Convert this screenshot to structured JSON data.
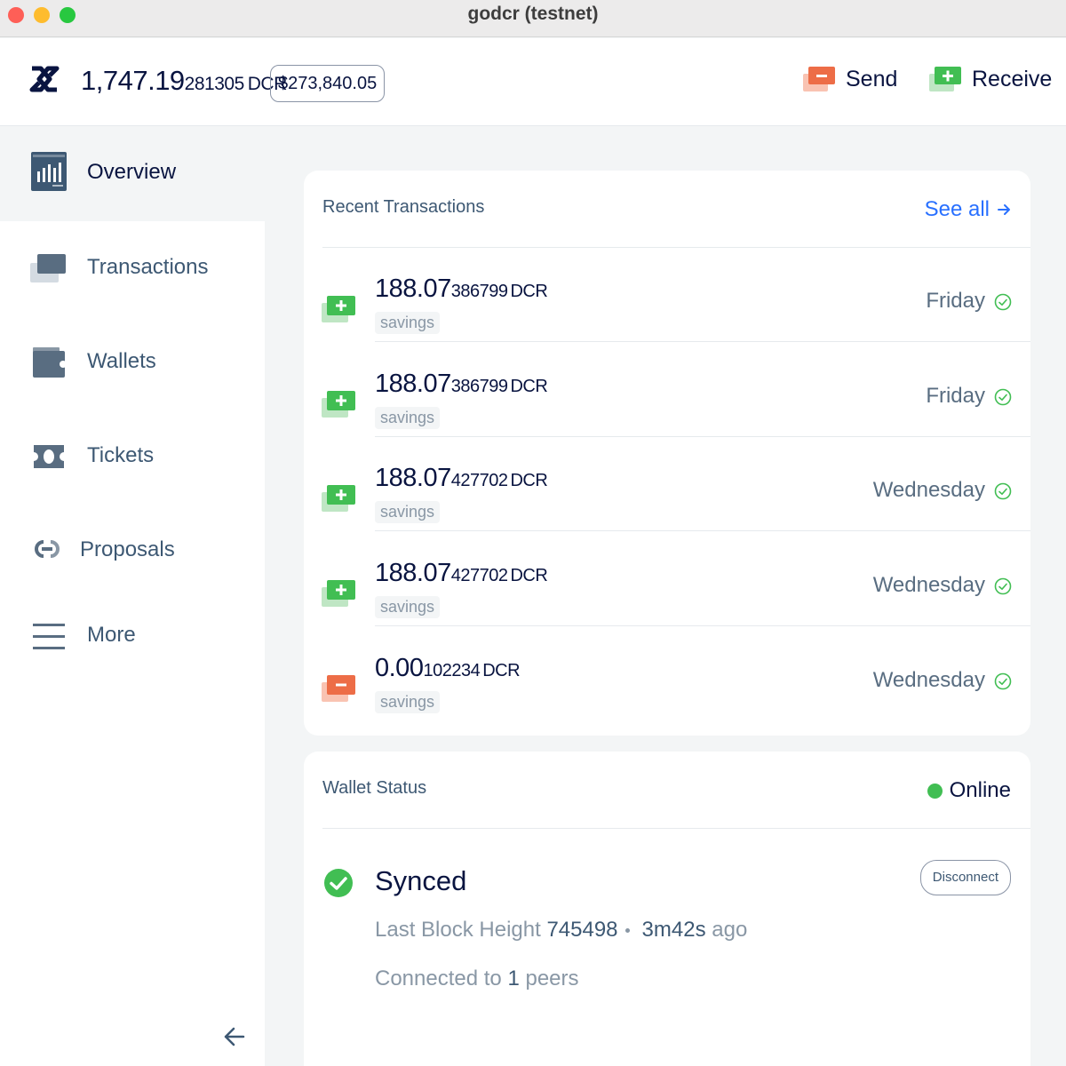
{
  "window": {
    "title": "godcr (testnet)"
  },
  "header": {
    "balance_main": "1,747.19",
    "balance_small": "281305",
    "balance_unit": "DCR",
    "usd_value": "$273,840.05",
    "send_label": "Send",
    "receive_label": "Receive"
  },
  "sidebar": {
    "items": [
      {
        "label": "Overview",
        "icon": "overview-icon",
        "active": true
      },
      {
        "label": "Transactions",
        "icon": "transactions-icon"
      },
      {
        "label": "Wallets",
        "icon": "wallets-icon"
      },
      {
        "label": "Tickets",
        "icon": "tickets-icon"
      },
      {
        "label": "Proposals",
        "icon": "proposals-icon"
      },
      {
        "label": "More",
        "icon": "more-icon"
      }
    ]
  },
  "recent": {
    "title": "Recent Transactions",
    "see_all": "See all",
    "transactions": [
      {
        "type": "received",
        "amount_main": "188.07",
        "amount_small": "386799",
        "unit": "DCR",
        "wallet": "savings",
        "date": "Friday",
        "status": "confirmed"
      },
      {
        "type": "received",
        "amount_main": "188.07",
        "amount_small": "386799",
        "unit": "DCR",
        "wallet": "savings",
        "date": "Friday",
        "status": "confirmed"
      },
      {
        "type": "received",
        "amount_main": "188.07",
        "amount_small": "427702",
        "unit": "DCR",
        "wallet": "savings",
        "date": "Wednesday",
        "status": "confirmed"
      },
      {
        "type": "received",
        "amount_main": "188.07",
        "amount_small": "427702",
        "unit": "DCR",
        "wallet": "savings",
        "date": "Wednesday",
        "status": "confirmed"
      },
      {
        "type": "sent",
        "amount_main": "0.00",
        "amount_small": "102234",
        "unit": "DCR",
        "wallet": "savings",
        "date": "Wednesday",
        "status": "confirmed"
      }
    ]
  },
  "status": {
    "title": "Wallet Status",
    "online_label": "Online",
    "sync_label": "Synced",
    "disconnect_label": "Disconnect",
    "block_label": "Last Block Height",
    "block_height": "745498",
    "block_age": "3m42s",
    "block_age_suffix": "ago",
    "connected_label": "Connected to",
    "peers_count": "1",
    "peers_label": "peers"
  },
  "colors": {
    "accent_blue": "#2970ff",
    "receive_green": "#41be53",
    "send_red": "#ed6d47",
    "text_dark": "#091440"
  }
}
